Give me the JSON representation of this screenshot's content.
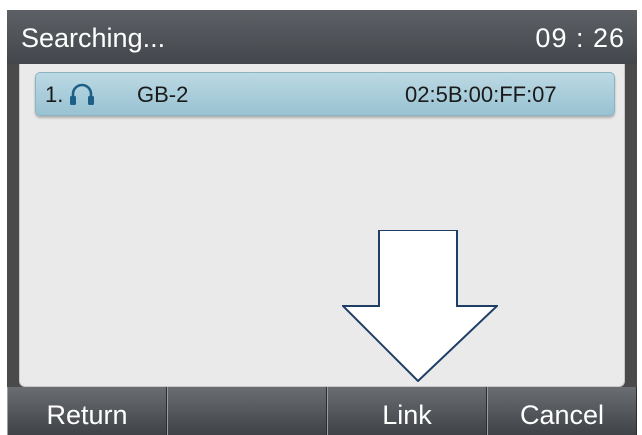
{
  "status": {
    "title": "Searching...",
    "time": "09 : 26"
  },
  "devices": [
    {
      "index": "1.",
      "icon": "headset-icon",
      "name": "GB-2",
      "mac": "02:5B:00:FF:07"
    }
  ],
  "softkeys": [
    {
      "label": "Return"
    },
    {
      "label": ""
    },
    {
      "label": "Link"
    },
    {
      "label": "Cancel"
    }
  ],
  "colors": {
    "status_bar": "#4a4e53",
    "list_background": "#eaeaea",
    "selected_item": "#a9cfdc",
    "softkey": "#55595e"
  }
}
